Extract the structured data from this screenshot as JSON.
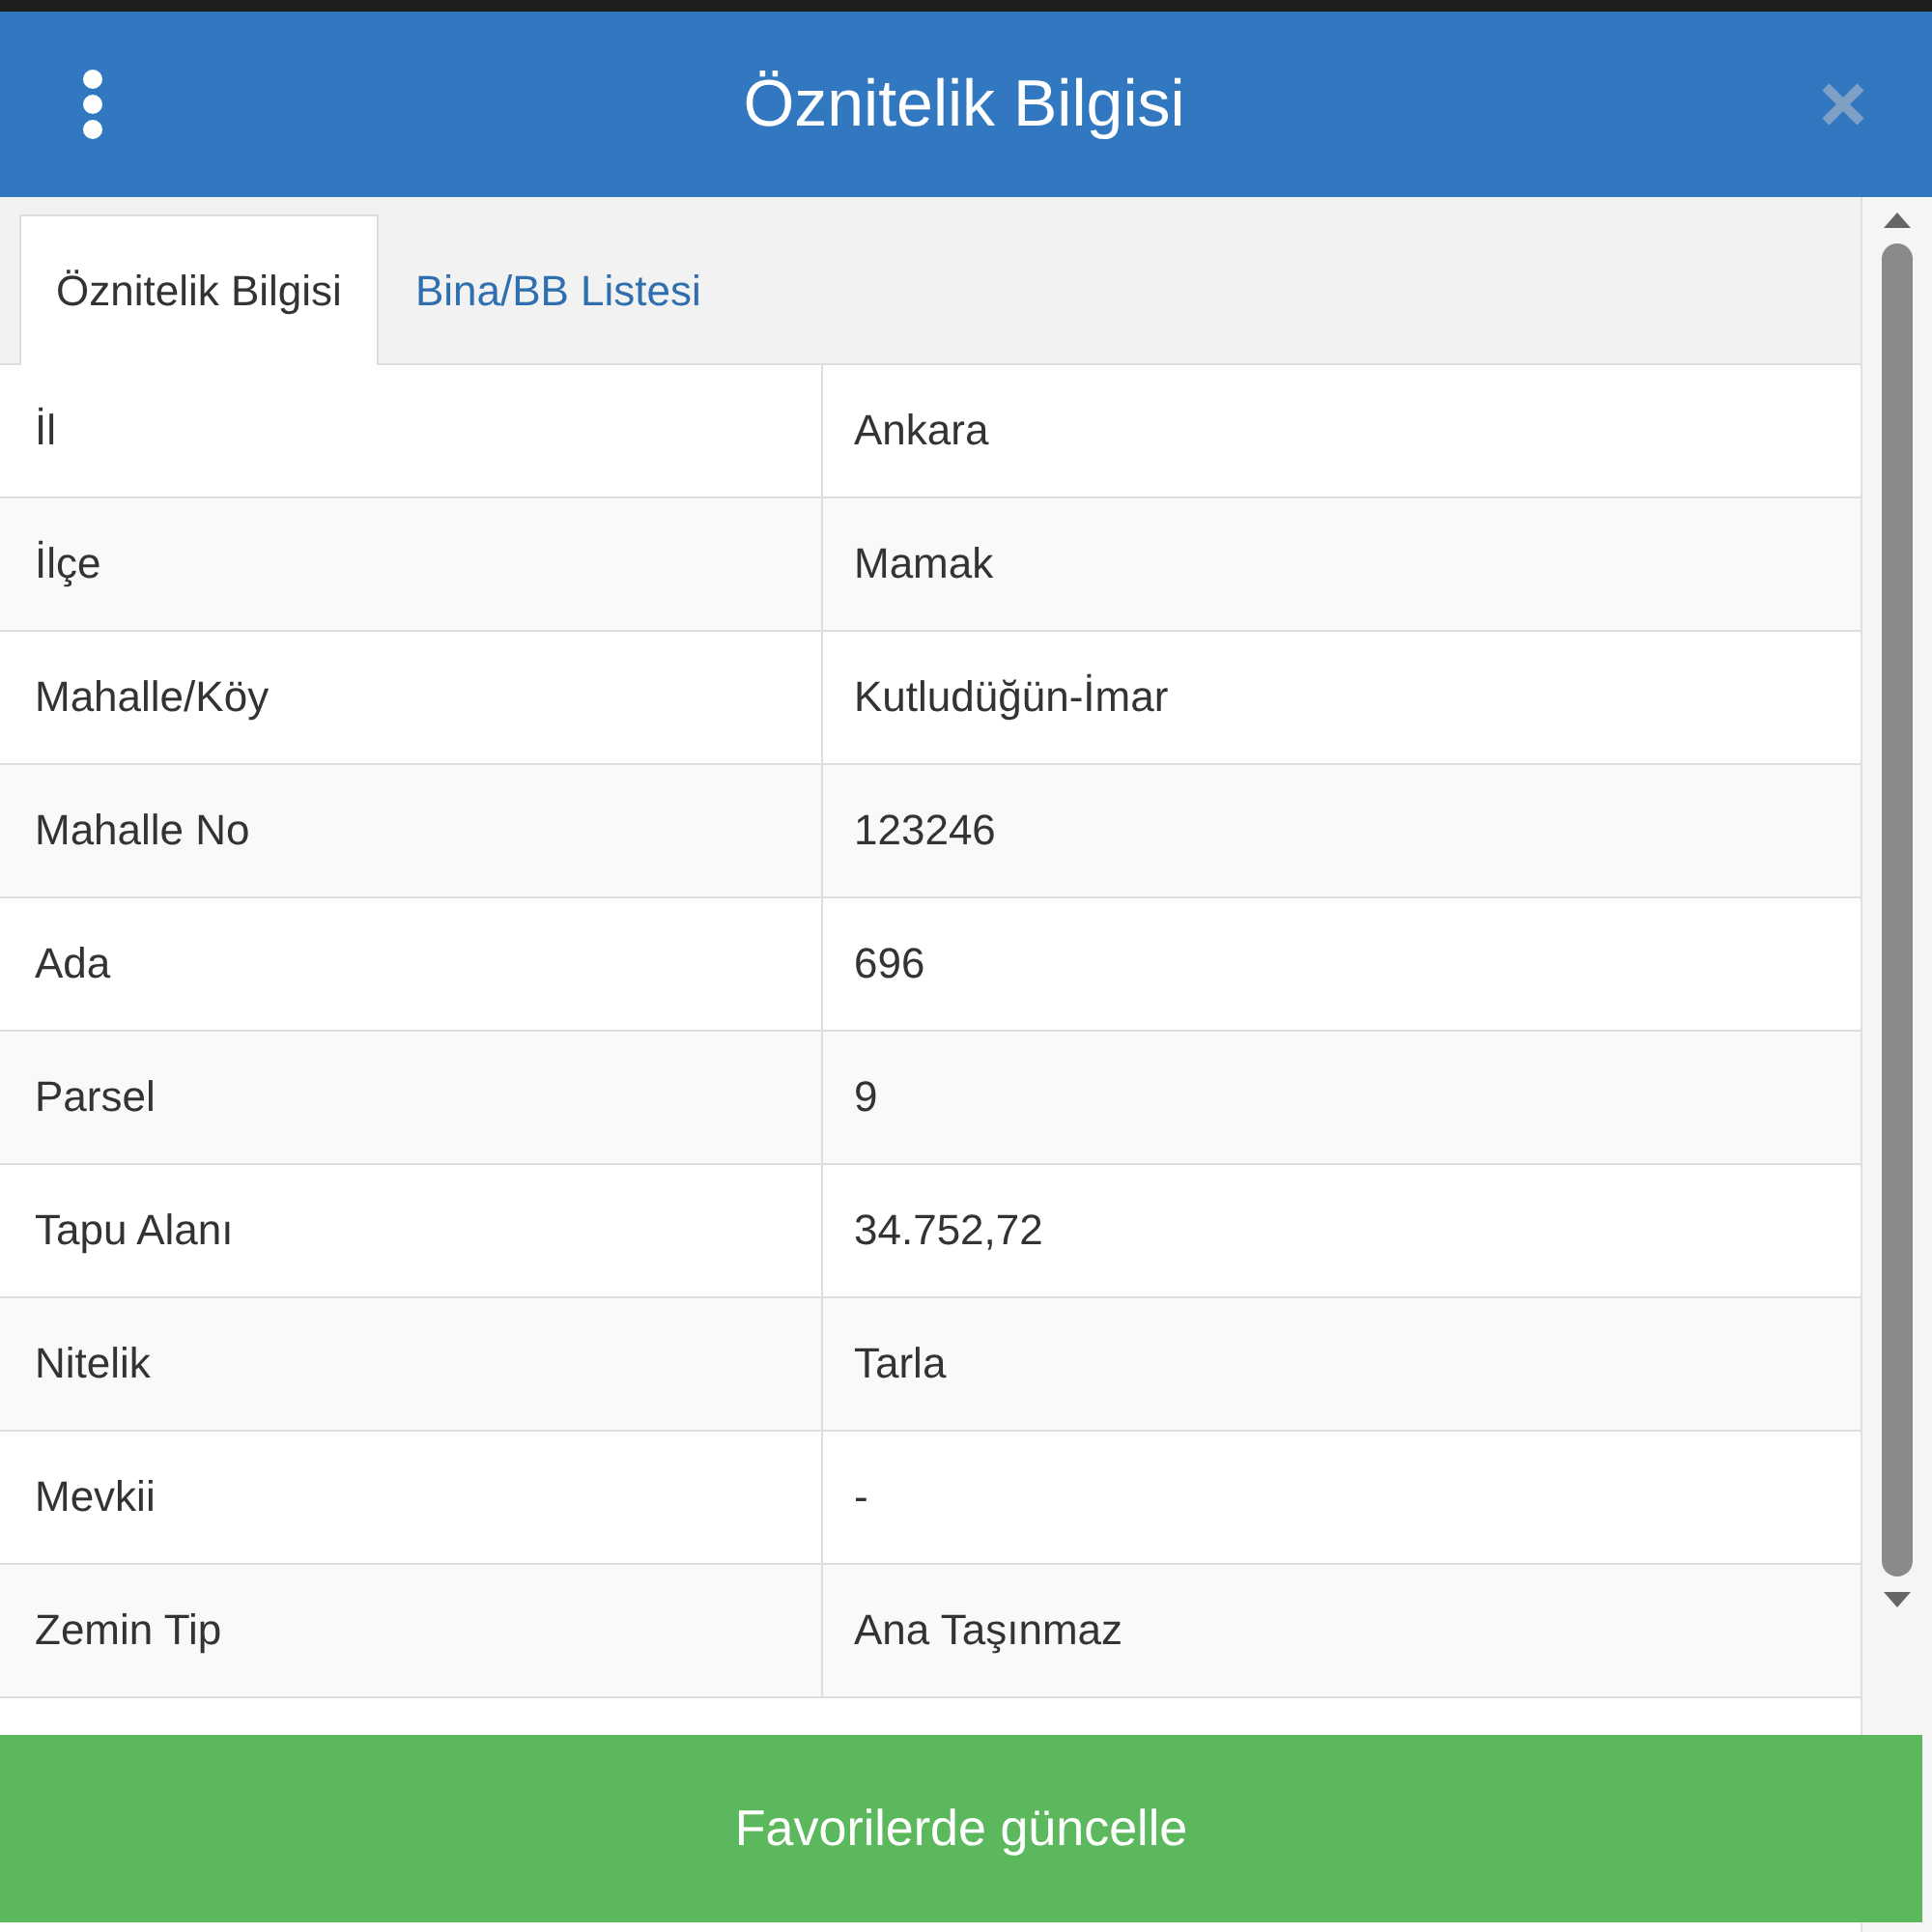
{
  "header": {
    "title": "Öznitelik Bilgisi"
  },
  "tabs": [
    {
      "label": "Öznitelik Bilgisi",
      "selected": true
    },
    {
      "label": "Bina/BB Listesi",
      "selected": false
    }
  ],
  "rows": [
    {
      "label": "İl",
      "value": "Ankara"
    },
    {
      "label": "İlçe",
      "value": "Mamak"
    },
    {
      "label": "Mahalle/Köy",
      "value": "Kutludüğün-İmar"
    },
    {
      "label": "Mahalle No",
      "value": "123246"
    },
    {
      "label": "Ada",
      "value": "696"
    },
    {
      "label": "Parsel",
      "value": "9"
    },
    {
      "label": "Tapu Alanı",
      "value": "34.752,72"
    },
    {
      "label": "Nitelik",
      "value": "Tarla"
    },
    {
      "label": "Mevkii",
      "value": "-"
    },
    {
      "label": "Zemin Tip",
      "value": "Ana Taşınmaz"
    }
  ],
  "footer_button": "Favorilerde güncelle"
}
